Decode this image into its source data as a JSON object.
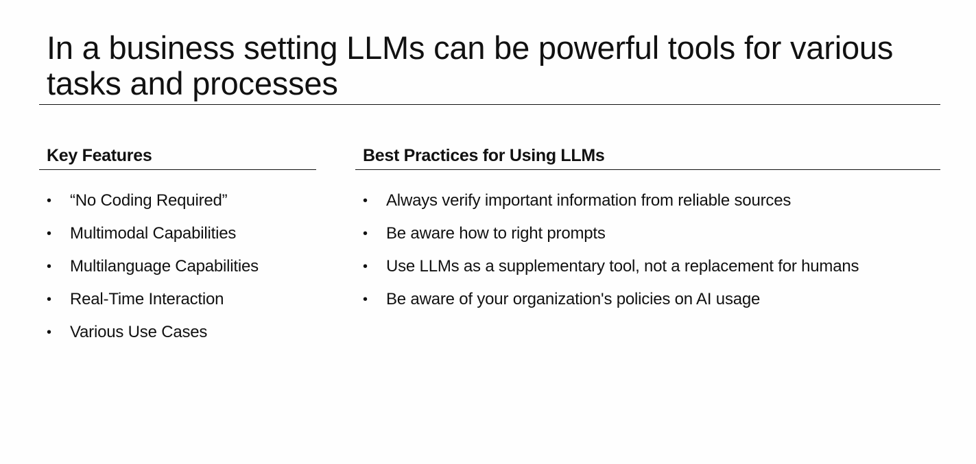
{
  "slide": {
    "title": "In a business setting LLMs can be powerful tools for various tasks and processes"
  },
  "left_column": {
    "heading": "Key Features",
    "items": [
      {
        "text": "“No Coding Required”"
      },
      {
        "text": "Multimodal Capabilities"
      },
      {
        "text": "Multilanguage Capabilities"
      },
      {
        "text": "Real-Time Interaction"
      },
      {
        "text": "Various Use Cases"
      }
    ]
  },
  "right_column": {
    "heading": "Best Practices for Using LLMs",
    "items": [
      {
        "text": "Always verify important information from reliable sources"
      },
      {
        "text": "Be aware how to right prompts"
      },
      {
        "text": "Use LLMs as a supplementary tool, not a replacement for humans"
      },
      {
        "text": "Be aware of your organization's policies on AI usage"
      }
    ]
  },
  "bullet_glyph": "•",
  "colors": {
    "text": "#111111",
    "background": "#fefefe",
    "rule": "#111111"
  }
}
